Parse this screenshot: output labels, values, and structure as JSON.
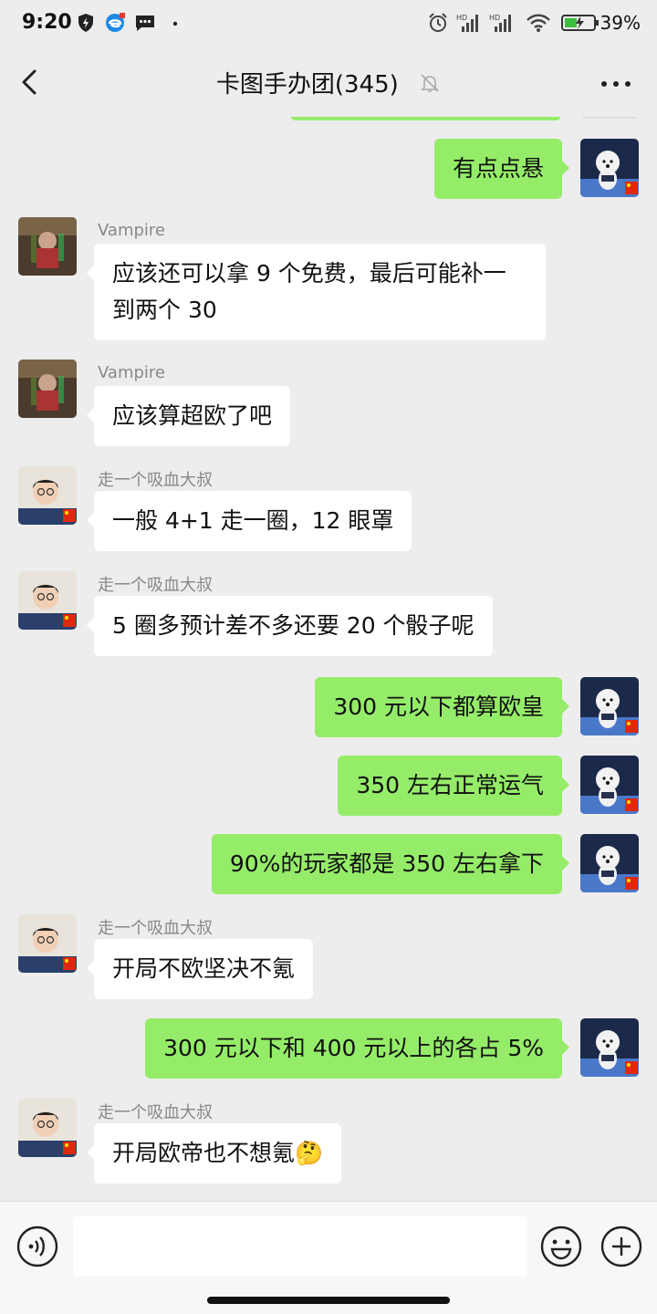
{
  "status_bar": {
    "time": "9:20",
    "battery_percent": "39%"
  },
  "header": {
    "title": "卡图手办团(345)"
  },
  "messages": [
    {
      "side": "right",
      "text": "有点点悬"
    },
    {
      "side": "left",
      "sender": "Vampire",
      "text": "应该还可以拿 9 个免费，最后可能补一到两个 30"
    },
    {
      "side": "left",
      "sender": "Vampire",
      "text": "应该算超欧了吧"
    },
    {
      "side": "left",
      "sender": "走一个吸血大叔",
      "text": "一般 4+1 走一圈，12 眼罩"
    },
    {
      "side": "left",
      "sender": "走一个吸血大叔",
      "text": "5 圈多预计差不多还要 20 个骰子呢"
    },
    {
      "side": "right",
      "text": "300 元以下都算欧皇"
    },
    {
      "side": "right",
      "text": "350 左右正常运气"
    },
    {
      "side": "right",
      "text": "90%的玩家都是 350 左右拿下"
    },
    {
      "side": "left",
      "sender": "走一个吸血大叔",
      "text": "开局不欧坚决不氪"
    },
    {
      "side": "right",
      "text": "300 元以下和 400 元以上的各占 5%"
    },
    {
      "side": "left",
      "sender": "走一个吸血大叔",
      "text": "开局欧帝也不想氪🤔"
    }
  ],
  "colors": {
    "outgoing_bubble": "#95ec69",
    "incoming_bubble": "#ffffff",
    "background": "#ededed"
  }
}
